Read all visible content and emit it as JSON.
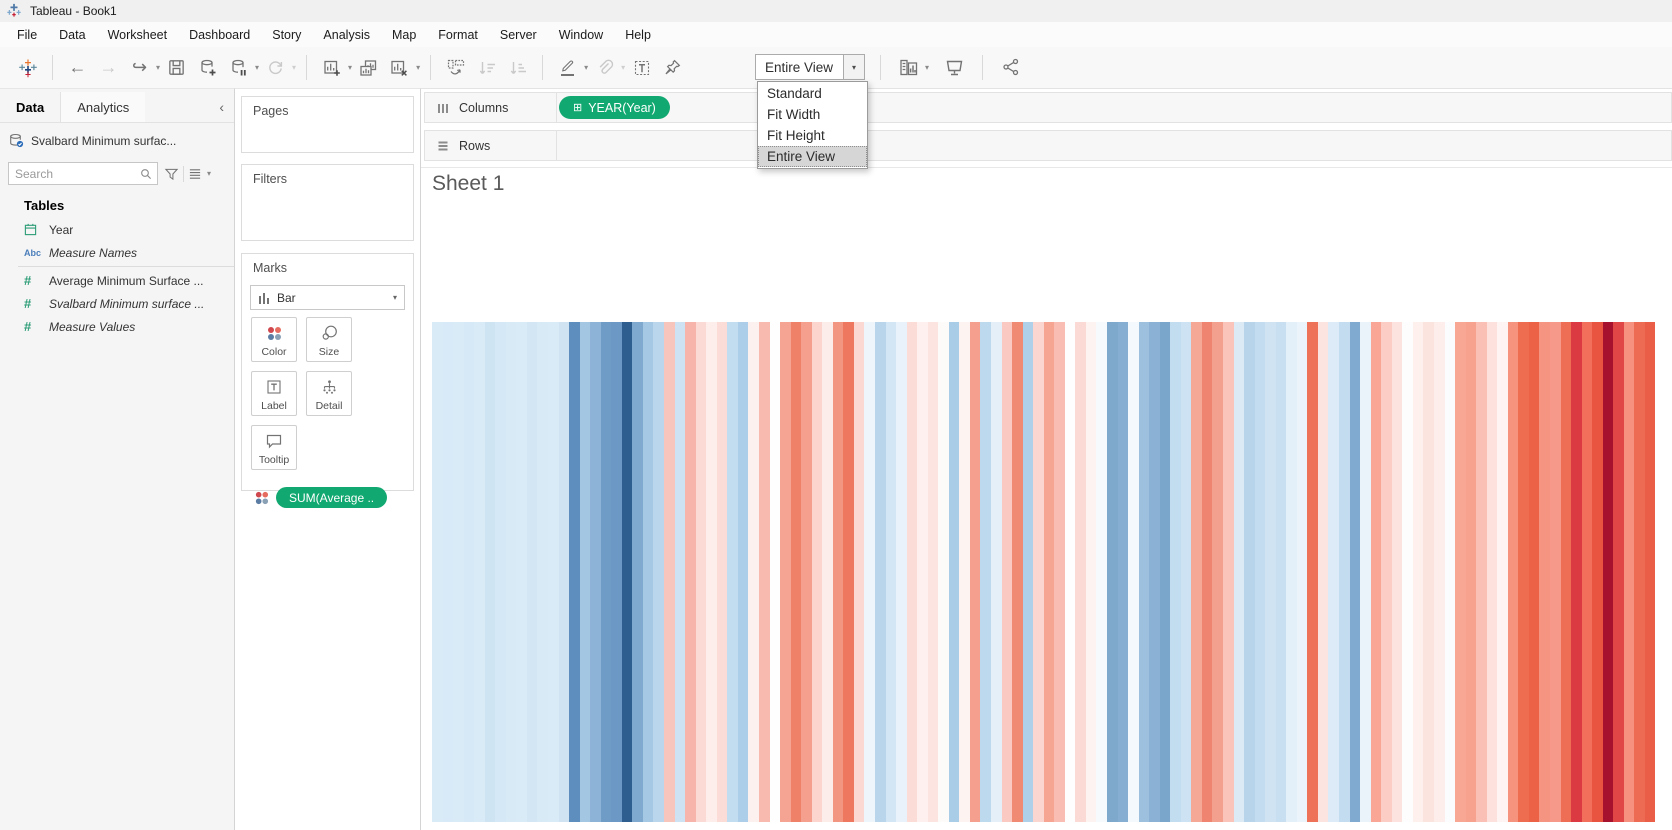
{
  "window": {
    "title": "Tableau - Book1"
  },
  "menubar": {
    "items": [
      "File",
      "Data",
      "Worksheet",
      "Dashboard",
      "Story",
      "Analysis",
      "Map",
      "Format",
      "Server",
      "Window",
      "Help"
    ]
  },
  "toolbar": {
    "fit": {
      "value": "Entire View",
      "selected": "Entire View",
      "options": [
        "Standard",
        "Fit Width",
        "Fit Height",
        "Entire View"
      ]
    },
    "button_names": [
      "tableau-logo",
      "undo",
      "redo",
      "replay",
      "save",
      "new-data-source",
      "pause-auto-updates",
      "run-auto-updates",
      "new-worksheet",
      "duplicate-sheet",
      "clear-sheet",
      "swap-rows-and-columns",
      "sort-ascending",
      "sort-descending",
      "highlight",
      "group-members",
      "show-mark-labels",
      "fix-axes",
      "fit-selector",
      "show-me",
      "presentation-mode",
      "share"
    ]
  },
  "sidebar": {
    "tabs": {
      "data": "Data",
      "analytics": "Analytics"
    },
    "datasource": "Svalbard Minimum surfac...",
    "search_placeholder": "Search",
    "tables_header": "Tables",
    "fields": [
      {
        "label": "Year",
        "icon": "calendar",
        "italic": false,
        "divider_after": false
      },
      {
        "label": "Measure Names",
        "icon": "abc",
        "italic": true,
        "divider_after": true
      },
      {
        "label": "Average Minimum Surface ...",
        "icon": "number",
        "italic": false,
        "divider_after": false
      },
      {
        "label": "Svalbard Minimum surface ...",
        "icon": "number",
        "italic": true,
        "divider_after": false
      },
      {
        "label": "Measure Values",
        "icon": "number",
        "italic": true,
        "divider_after": false
      }
    ]
  },
  "cards": {
    "pages": "Pages",
    "filters": "Filters",
    "marks": "Marks",
    "mark_type": "Bar",
    "buttons": [
      "Color",
      "Size",
      "Label",
      "Detail",
      "Tooltip"
    ],
    "color_pill": "SUM(Average .."
  },
  "shelves": {
    "columns": "Columns",
    "rows": "Rows",
    "columns_pills": [
      "YEAR(Year)"
    ]
  },
  "sheet": {
    "title": "Sheet 1"
  },
  "chart_data": {
    "type": "bar",
    "title": "Sheet 1",
    "x_field": "YEAR(Year)",
    "color_field": "SUM(Average Minimum Surface ...)",
    "note": "Warming-stripes view: one full-height bar per year, colored blue (cold) to red (warm); no axes or labels shown",
    "stripe_colors": [
      "#d9ebf7",
      "#d8eaf7",
      "#d9ebf7",
      "#d6e9f6",
      "#d9ebf7",
      "#cfe4f3",
      "#d5e8f5",
      "#d8eaf6",
      "#d9ebf7",
      "#d3e6f4",
      "#d8eaf6",
      "#d9ebf7",
      "#cfe3f3",
      "#5d8ebd",
      "#a3c7e3",
      "#8db4d6",
      "#6f9cc6",
      "#6b98c4",
      "#2e5e90",
      "#7fa9cf",
      "#a5c9e4",
      "#b9d6ec",
      "#f8c5bd",
      "#cde2f3",
      "#f6b4aa",
      "#fbd9d4",
      "#fdeeec",
      "#fbdcd7",
      "#c2dcf0",
      "#accee8",
      "#fdf1ef",
      "#f8b9ae",
      "#fefefe",
      "#f5a392",
      "#ef8168",
      "#f5a08f",
      "#fbd5ce",
      "#fdedea",
      "#f29581",
      "#ee7760",
      "#fbd8d2",
      "#eef5fb",
      "#b8d5ec",
      "#d3e6f5",
      "#e9f2fa",
      "#fbdcd7",
      "#fdf0ee",
      "#fce4e0",
      "#fdfafa",
      "#a9cce7",
      "#fdf4f2",
      "#f5a08f",
      "#bdd9ee",
      "#e4eff8",
      "#fac9c1",
      "#f08a72",
      "#afd0e9",
      "#fbd6d0",
      "#f5a592",
      "#f9bdb3",
      "#fefefe",
      "#fbd9d4",
      "#fdf3f1",
      "#f7fafd",
      "#7fa8cd",
      "#85aed2",
      "#f4f9fd",
      "#9cc0de",
      "#8bb2d5",
      "#7ba6cc",
      "#c3ddf0",
      "#cde2f2",
      "#f6a896",
      "#ef8570",
      "#f4a08e",
      "#fac4bb",
      "#dceaf6",
      "#b8d4eb",
      "#c4dcf0",
      "#cfe3f3",
      "#c8dff1",
      "#e3eff9",
      "#ebf4fb",
      "#ee7257",
      "#fce4e1",
      "#dcebf7",
      "#c3dcf0",
      "#80aacf",
      "#eaf3fa",
      "#f9a696",
      "#fbcdc5",
      "#fce3df",
      "#fdfdfd",
      "#fdf0ed",
      "#fbe3de",
      "#fdeeeb",
      "#fafcfe",
      "#f9a795",
      "#f7a28f",
      "#fac0b6",
      "#fce1dc",
      "#fdf4f3",
      "#f5937e",
      "#ee6c50",
      "#ec6246",
      "#f59480",
      "#f6998a",
      "#ee6e55",
      "#dc3a42",
      "#f2705b",
      "#e95440",
      "#a6112d",
      "#e14646",
      "#f69180",
      "#ed6b53",
      "#ea5e48"
    ]
  },
  "icons": {
    "caret_down": "▾",
    "collapse_left": "‹",
    "expand_plus": "⊞",
    "hash": "#",
    "abc": "Abc",
    "back_arrow": "←",
    "forward_arrow": "→",
    "redo_arrow": "↪"
  },
  "colors": {
    "pill_green": "#12a871",
    "selected_item_bg": "#d6d6d6",
    "sidebar_bg": "#f5f5f5",
    "toolbar_icon": "#737373"
  }
}
